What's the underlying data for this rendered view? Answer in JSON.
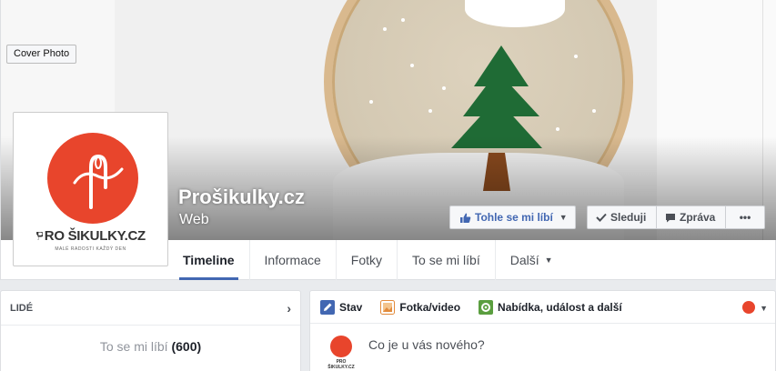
{
  "cover": {
    "button_label": "Cover Photo"
  },
  "profile": {
    "logo_name": "PRO ŠIKULKY.CZ",
    "logo_tagline": "MALÉ RADOSTI KAŽDÝ DEN"
  },
  "page": {
    "title": "Prošikulky.cz",
    "category": "Web"
  },
  "actions": {
    "like": "Tohle se mi líbí",
    "follow": "Sleduji",
    "message": "Zpráva",
    "more": "•••"
  },
  "tabs": [
    {
      "label": "Timeline"
    },
    {
      "label": "Informace"
    },
    {
      "label": "Fotky"
    },
    {
      "label": "To se mi líbí"
    },
    {
      "label": "Další"
    }
  ],
  "people": {
    "heading": "LIDÉ",
    "likes_text": "To se mi líbí",
    "likes_count": "(600)"
  },
  "composer": {
    "tabs": [
      {
        "label": "Stav"
      },
      {
        "label": "Fotka/video"
      },
      {
        "label": "Nabídka, událost a další"
      }
    ],
    "placeholder": "Co je u vás nového?",
    "avatar_text": "PRO ŠIKULKY.CZ"
  },
  "colors": {
    "accent": "#4267b2",
    "brand": "#e8452c"
  }
}
